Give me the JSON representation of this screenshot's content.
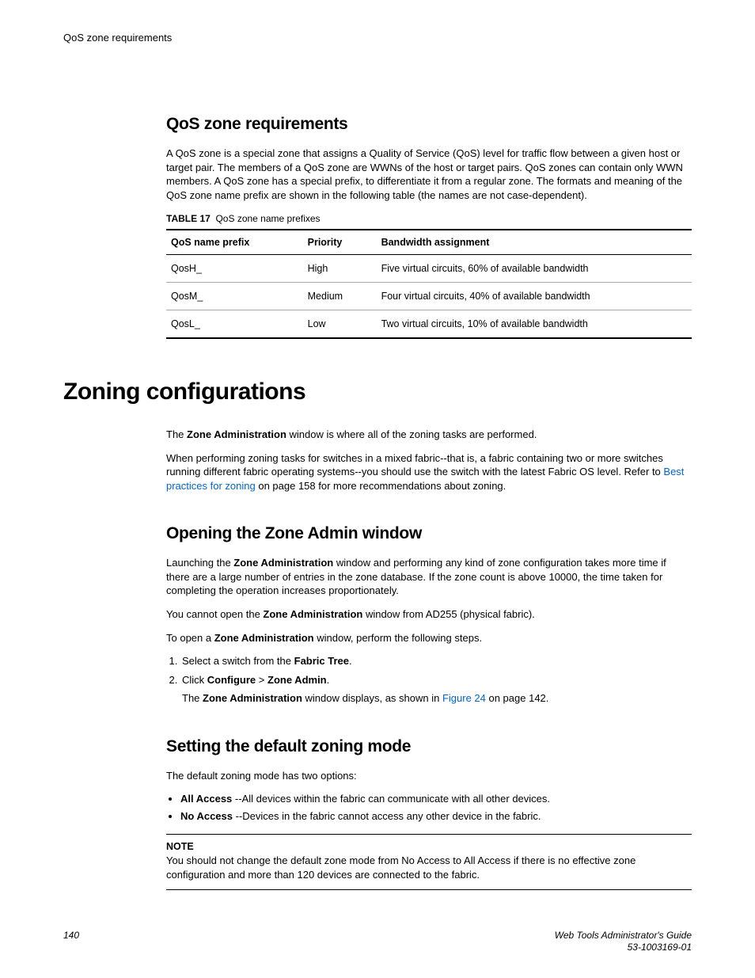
{
  "running_head": "QoS zone requirements",
  "sec1": {
    "title": "QoS zone requirements",
    "p1": "A QoS zone is a special zone that assigns a Quality of Service (QoS) level for traffic flow between a given host or target pair. The members of a QoS zone are WWNs of the host or target pairs. QoS zones can contain only WWN members. A QoS zone has a special prefix, to differentiate it from a regular zone. The formats and meaning of the QoS zone name prefix are shown in the following table (the names are not case-dependent).",
    "table": {
      "label": "TABLE 17",
      "caption": "QoS zone name prefixes",
      "headers": {
        "c1": "QoS name prefix",
        "c2": "Priority",
        "c3": "Bandwidth assignment"
      },
      "rows": [
        {
          "c1": "QosH_",
          "c2": "High",
          "c3": "Five virtual circuits, 60% of available bandwidth"
        },
        {
          "c1": "QosM_",
          "c2": "Medium",
          "c3": "Four virtual circuits, 40% of available bandwidth"
        },
        {
          "c1": "QosL_",
          "c2": "Low",
          "c3": "Two virtual circuits, 10% of available bandwidth"
        }
      ]
    }
  },
  "sec2": {
    "title": "Zoning configurations",
    "p1a": "The ",
    "p1b": "Zone Administration",
    "p1c": " window is where all of the zoning tasks are performed.",
    "p2a": "When performing zoning tasks for switches in a mixed fabric--that is, a fabric containing two or more switches running different fabric operating systems--you should use the switch with the latest Fabric OS level. Refer to ",
    "p2link": "Best practices for zoning",
    "p2b": " on page 158 for more recommendations about zoning."
  },
  "sec3": {
    "title": "Opening the Zone Admin window",
    "p1a": "Launching the ",
    "p1b": "Zone Administration",
    "p1c": " window and performing any kind of zone configuration takes more time if there are a large number of entries in the zone database. If the zone count is above 10000, the time taken for completing the operation increases proportionately.",
    "p2a": "You cannot open the ",
    "p2b": "Zone Administration",
    "p2c": " window from AD255 (physical fabric).",
    "p3a": "To open a ",
    "p3b": "Zone Administration",
    "p3c": " window, perform the following steps.",
    "step1a": "Select a switch from the ",
    "step1b": "Fabric Tree",
    "step1c": ".",
    "step2a": "Click ",
    "step2b": "Configure ",
    "step2c": " > ",
    "step2d": "Zone Admin",
    "step2e": ".",
    "step2suba": "The ",
    "step2subb": "Zone Administration",
    "step2subc": " window displays, as shown in ",
    "step2sublink": "Figure 24",
    "step2subd": " on page 142."
  },
  "sec4": {
    "title": "Setting the default zoning mode",
    "p1": "The default zoning mode has two options:",
    "b1a": "All Access",
    "b1b": " --All devices within the fabric can communicate with all other devices.",
    "b2a": "No Access",
    "b2b": " --Devices in the fabric cannot access any other device in the fabric.",
    "note_label": "NOTE",
    "note_text": "You should not change the default zone mode from No Access to All Access if there is no effective zone configuration and more than 120 devices are connected to the fabric."
  },
  "chart_data": {
    "type": "table",
    "title": "QoS zone name prefixes",
    "columns": [
      "QoS name prefix",
      "Priority",
      "Bandwidth assignment"
    ],
    "rows": [
      [
        "QosH_",
        "High",
        "Five virtual circuits, 60% of available bandwidth"
      ],
      [
        "QosM_",
        "Medium",
        "Four virtual circuits, 40% of available bandwidth"
      ],
      [
        "QosL_",
        "Low",
        "Two virtual circuits, 10% of available bandwidth"
      ]
    ]
  },
  "footer": {
    "page": "140",
    "title": "Web Tools Administrator's Guide",
    "docnum": "53-1003169-01"
  }
}
